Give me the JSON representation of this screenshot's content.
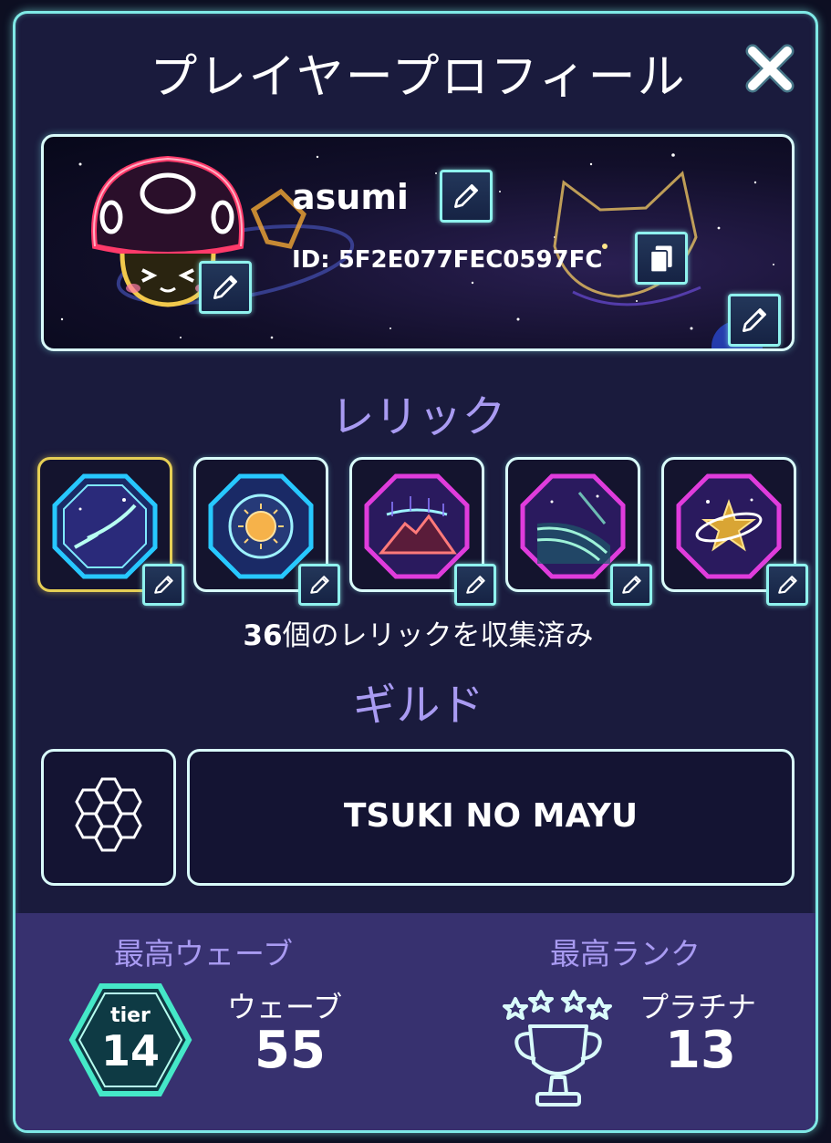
{
  "header": {
    "title": "プレイヤープロフィール",
    "close_icon": "close-x-icon"
  },
  "profile": {
    "username": "asumi",
    "player_id": "ID: 5F2E077FEC0597FC",
    "avatar": "mushroom-avatar"
  },
  "relics": {
    "title": "レリック",
    "collected_count": "36",
    "collected_suffix": "個のレリックを収集済み",
    "items": [
      {
        "name": "aurora-relic",
        "selected": true
      },
      {
        "name": "sun-relic",
        "selected": false
      },
      {
        "name": "volcano-relic",
        "selected": false
      },
      {
        "name": "wave-relic",
        "selected": false
      },
      {
        "name": "planet-star-relic",
        "selected": false
      }
    ]
  },
  "guild": {
    "title": "ギルド",
    "name": "TSUKI NO MAYU",
    "emblem": "hexagon-cluster-icon"
  },
  "stats": {
    "best_wave": {
      "label": "最高ウェーブ",
      "tier_label": "tier",
      "tier_value": "14",
      "sub_label": "ウェーブ",
      "value": "55"
    },
    "best_rank": {
      "label": "最高ランク",
      "sub_label": "プラチナ",
      "value": "13"
    }
  },
  "colors": {
    "accent_cyan": "#7fe9e6",
    "title_purple": "#a99bf2",
    "panel_bg": "#1a1b3d",
    "stats_bg": "#37316f",
    "selected_gold": "#e6cf55"
  }
}
